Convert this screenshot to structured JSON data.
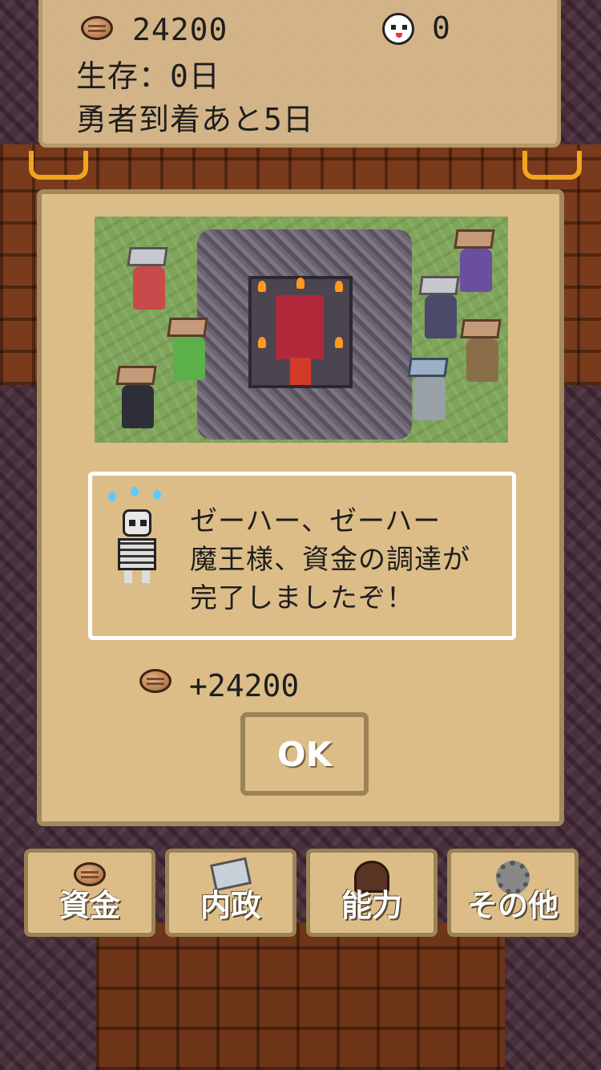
{
  "status": {
    "money": "24200",
    "souls": "0",
    "survival": "生存：0日",
    "hero_arrival": "勇者到着あと5日"
  },
  "dialog": {
    "message_lines": [
      "ゼーハー、ゼーハー",
      "魔王様、資金の調達が",
      "完了しましたぞ！"
    ],
    "reward": "+24200",
    "ok_label": "OK"
  },
  "menu": {
    "items": [
      {
        "label": "資金",
        "icon": "coin-icon"
      },
      {
        "label": "内政",
        "icon": "scroll-icon"
      },
      {
        "label": "能力",
        "icon": "demon-icon"
      },
      {
        "label": "その他",
        "icon": "gear-icon"
      }
    ]
  },
  "colors": {
    "panel": "#dcbd88",
    "panel_border": "#a38a5c",
    "text": "#1e1e1e"
  }
}
